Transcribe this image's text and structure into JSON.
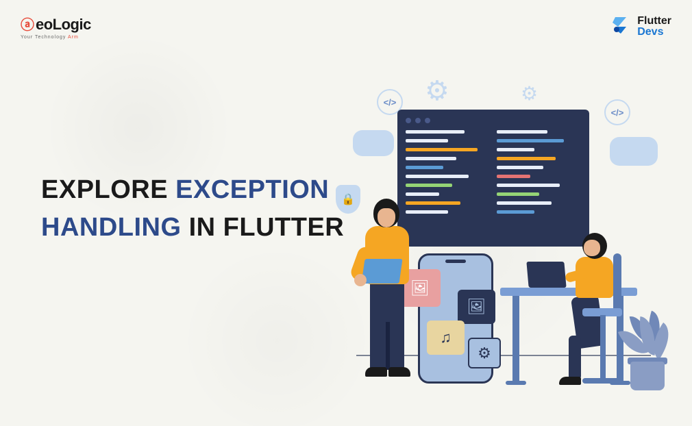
{
  "logos": {
    "aeologic": {
      "prefix_icon": "Ⓐ",
      "name": "eoLogic",
      "tagline_a": "Your Technology",
      "tagline_b": "Arm"
    },
    "flutterdevs": {
      "line1": "Flutter",
      "line2": "Devs"
    }
  },
  "headline": {
    "w1": "EXPLORE ",
    "w2": "EXCEPTION",
    "w3": "HANDLING",
    "w4": " IN FLUTTER"
  },
  "icons": {
    "gear": "⚙",
    "code_tag": "</>",
    "shield_lock": "🔒",
    "image": "🖼",
    "music": "♫",
    "settings": "⚙"
  }
}
